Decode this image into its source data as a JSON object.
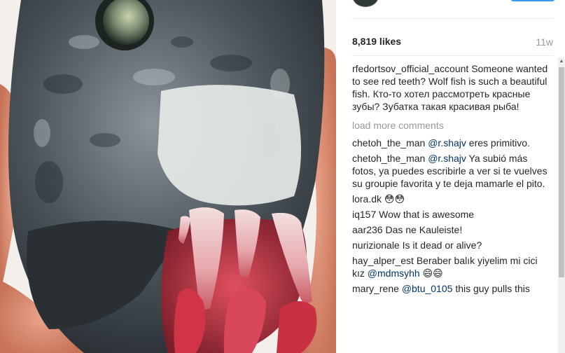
{
  "post": {
    "likes": "8,819 likes",
    "time_ago": "11w"
  },
  "caption": {
    "user": "rfedortsov_official_account",
    "text": "Someone wanted to see red teeth? Wolf fish is such a beautiful fish. Кто-то хотел рассмотреть красные зубы? Зубатка такая красивая рыба!"
  },
  "load_more": "load more comments",
  "comments": [
    {
      "user": "chetoh_the_man",
      "mention": "@r.shajv",
      "text": "eres primitivo."
    },
    {
      "user": "chetoh_the_man",
      "mention": "@r.shajv",
      "text": "Ya subió más fotos, ya puedes escribirle a ver si te vuelves su groupie favorita y te deja mamarle el pito."
    },
    {
      "user": "lora.dk",
      "text": "😳😳"
    },
    {
      "user": "iq157",
      "text": "Wow that is awesome"
    },
    {
      "user": "aar236",
      "text": "Das ne Kauleiste!"
    },
    {
      "user": "nurizionale",
      "text": "Is it dead or alive?"
    },
    {
      "user": "hay_alper_est",
      "text": "Beraber balık yiyelim mi cici kız",
      "mention": "@mdmsyhh",
      "text_after": "😄😄"
    },
    {
      "user": "mary_rene",
      "mention": "@btu_0105",
      "text": "this guy pulls this"
    }
  ],
  "icons": {
    "scroll_up": "scroll-up-arrow-icon"
  },
  "colors": {
    "mention": "#003569",
    "muted": "#999999",
    "accent": "#3897f0"
  }
}
